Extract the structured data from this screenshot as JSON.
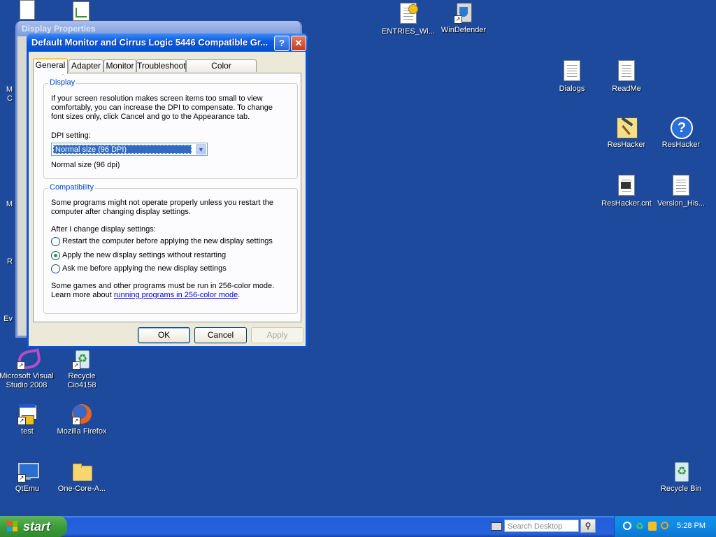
{
  "desktop": {
    "icons": [
      {
        "label": "ENTRIES_Wi...",
        "icon": "settings-doc-icon"
      },
      {
        "label": "WinDefender",
        "icon": "windefender-icon"
      },
      {
        "label": "Dialogs",
        "icon": "text-doc-icon"
      },
      {
        "label": "ReadMe",
        "icon": "text-doc-icon"
      },
      {
        "label": "ResHacker",
        "icon": "hammer-icon"
      },
      {
        "label": "ResHacker",
        "icon": "help-icon"
      },
      {
        "label": "ResHacker.cnt",
        "icon": "text-doc-icon"
      },
      {
        "label": "Version_His...",
        "icon": "text-doc-icon"
      },
      {
        "label": "Microsoft Visual Studio 2008",
        "icon": "visual-studio-icon"
      },
      {
        "label": "Recycle Cio4158",
        "icon": "recycle-icon"
      },
      {
        "label": "test",
        "icon": "app-icon"
      },
      {
        "label": "Mozilla Firefox",
        "icon": "firefox-icon"
      },
      {
        "label": "QtEmu",
        "icon": "monitor-icon"
      },
      {
        "label": "One-Core-A...",
        "icon": "folder-icon"
      },
      {
        "label": "Recycle Bin",
        "icon": "recycle-bin-icon"
      }
    ],
    "partial_labels": [
      "M",
      "C",
      "M",
      "R",
      "Ev"
    ]
  },
  "back_window": {
    "title": "Display Properties"
  },
  "dialog": {
    "title": "Default Monitor and Cirrus Logic 5446 Compatible Gr...",
    "help_button": "?",
    "close_button": "✕",
    "tabs": [
      "General",
      "Adapter",
      "Monitor",
      "Troubleshoot",
      "Color Management"
    ],
    "active_tab": "General",
    "display_group": {
      "legend": "Display",
      "description_line1": "If your screen resolution makes screen items too small to view",
      "description_line2": "comfortably, you can increase the DPI to compensate.  To change",
      "description_line3": "font sizes only, click Cancel and go to the Appearance tab.",
      "dpi_label": "DPI setting:",
      "dpi_value": "Normal size (96 DPI)",
      "dpi_note": "Normal size (96 dpi)"
    },
    "compat_group": {
      "legend": "Compatibility",
      "text_line1": "Some programs might not operate properly unless you restart the",
      "text_line2": "computer after changing display settings.",
      "after_label": "After I change display settings:",
      "options": [
        {
          "label": "Restart the computer before applying the new display settings",
          "selected": false
        },
        {
          "label": "Apply the new display settings without restarting",
          "selected": true
        },
        {
          "label": "Ask me before applying the new display settings",
          "selected": false
        }
      ],
      "footer_line1": "Some games and other programs must be run in 256-color mode.",
      "footer_line2_prefix": "Learn more about ",
      "footer_link": "running programs in 256-color mode",
      "footer_suffix": "."
    },
    "buttons": {
      "ok": "OK",
      "cancel": "Cancel",
      "apply": "Apply"
    }
  },
  "taskbar": {
    "start_label": "start",
    "search_placeholder": "Search Desktop",
    "clock": "5:28 PM"
  }
}
